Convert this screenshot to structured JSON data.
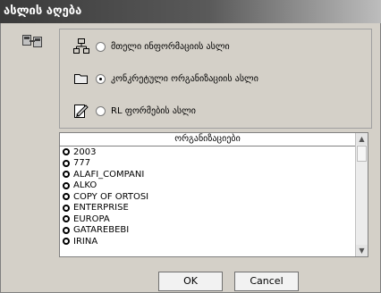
{
  "window": {
    "title": "ასლის აღება"
  },
  "options": [
    {
      "label": "მთელი ინფორმაციის ასლი",
      "selected": false,
      "icon": "tree-structure-icon"
    },
    {
      "label": "კონკრეტული ორგანიზაციის ასლი",
      "selected": true,
      "icon": "folder-icon"
    },
    {
      "label": "RL ფორმების ასლი",
      "selected": false,
      "icon": "edit-pencil-icon"
    }
  ],
  "list": {
    "header": "ორგანიზაციები",
    "items": [
      "2003",
      "777",
      "ALAFI_COMPANI",
      "ALKO",
      "COPY OF ORTOSI",
      "ENTERPRISE",
      "EUROPA",
      "GATAREBEBI",
      "IRINA"
    ]
  },
  "buttons": {
    "ok": "OK",
    "cancel": "Cancel"
  },
  "colors": {
    "dialog_bg": "#d4d0c8",
    "title_bg": "#3a3a3a"
  }
}
